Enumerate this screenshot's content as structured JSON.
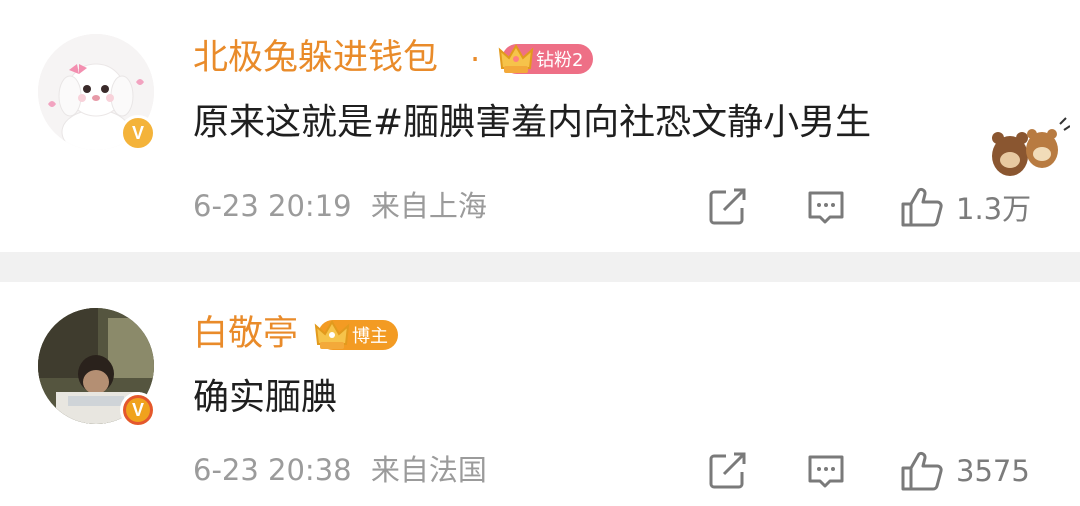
{
  "comments": [
    {
      "username": "北极兔躲进钱包",
      "badge_label": "钻粉2",
      "text": "原来这就是#腼腆害羞内向社恐文静小男生",
      "timestamp": "6-23 20:19",
      "location": "来自上海",
      "likes": "1.3万",
      "colors": {
        "badge": "#ee6f86",
        "verified": "#f4b33a"
      }
    },
    {
      "username": "白敬亭",
      "badge_label": "博主",
      "text": "确实腼腆",
      "timestamp": "6-23 20:38",
      "location": "来自法国",
      "likes": "3575",
      "colors": {
        "badge": "#f39b23",
        "verified": "#f0a21d"
      }
    }
  ],
  "theme": {
    "username_color": "#e98b2a",
    "meta_color": "#9b9b9b",
    "divider_color": "#f1f1f1"
  }
}
